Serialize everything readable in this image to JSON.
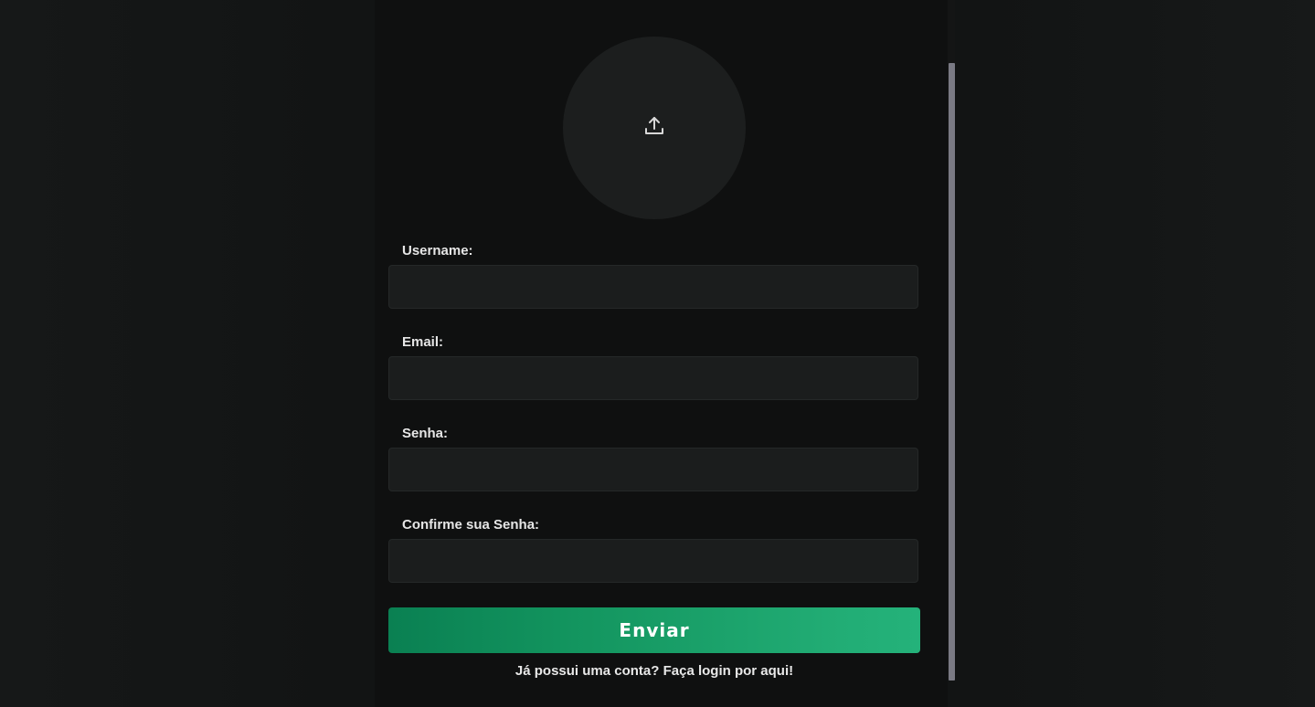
{
  "avatar": {
    "icon": "upload-icon"
  },
  "form": {
    "username_label": "Username:",
    "email_label": "Email:",
    "password_label": "Senha:",
    "confirm_password_label": "Confirme sua Senha:",
    "username_value": "",
    "email_value": "",
    "password_value": "",
    "confirm_password_value": ""
  },
  "submit_label": "Enviar",
  "login_link_text": "Já possui uma conta? Faça login por aqui!",
  "colors": {
    "background": "#0f1010",
    "input_background": "#1b1d1d",
    "button_gradient_start": "#0a8052",
    "button_gradient_end": "#24b27a",
    "scrollbar_thumb": "#7a7a84"
  }
}
